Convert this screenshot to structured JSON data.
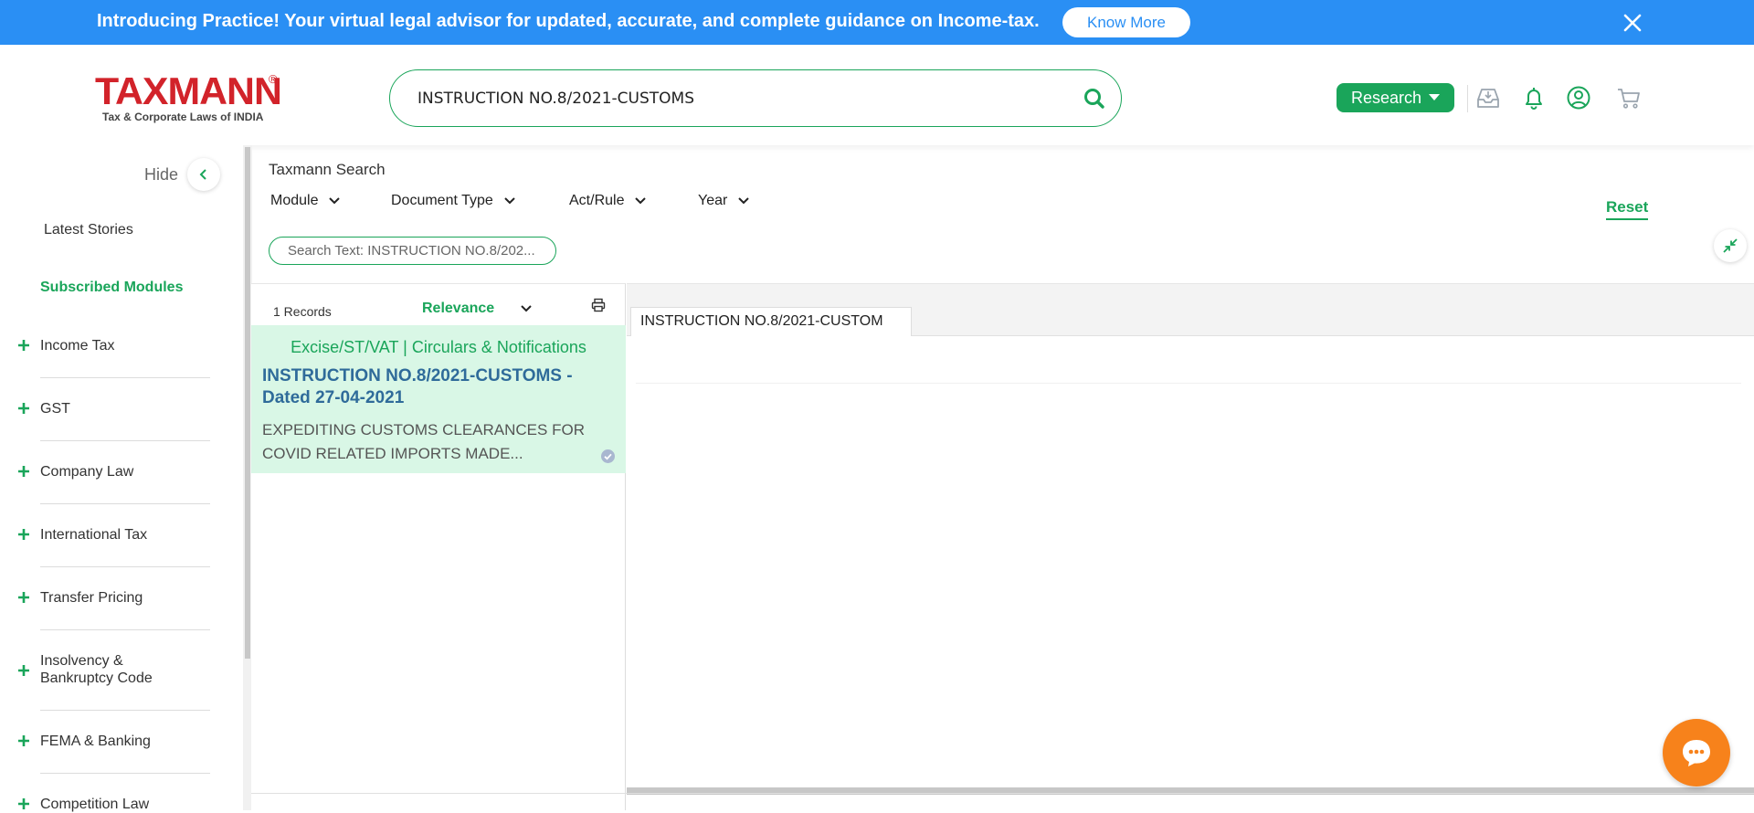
{
  "banner": {
    "text": "Introducing Practice! Your virtual legal advisor for updated, accurate, and complete guidance on Income-tax.",
    "button_label": "Know More",
    "background_color": "#2a8ff4",
    "close_icon": "close-icon"
  },
  "header": {
    "logo_text": "TAXMANN",
    "logo_registered": "®",
    "logo_tagline": "Tax & Corporate Laws of INDIA",
    "search_value": "INSTRUCTION NO.8/2021-CUSTOMS",
    "search_icon": "search-icon",
    "research_label": "Research",
    "icons": [
      "inbox-icon",
      "bell-icon",
      "user-icon",
      "cart-icon"
    ],
    "brand_color": "#d2232a",
    "accent_color": "#1aa55a"
  },
  "sidebar": {
    "hide_label": "Hide",
    "latest_stories": "Latest Stories",
    "subscribed_modules": "Subscribed Modules",
    "modules": [
      {
        "label": "Income Tax"
      },
      {
        "label": "GST"
      },
      {
        "label": "Company Law"
      },
      {
        "label": "International Tax"
      },
      {
        "label": "Transfer Pricing"
      },
      {
        "label": "Insolvency & Bankruptcy Code"
      },
      {
        "label": "FEMA & Banking"
      },
      {
        "label": "Competition Law"
      }
    ]
  },
  "search_panel": {
    "title": "Taxmann Search",
    "filters": [
      {
        "label": "Module"
      },
      {
        "label": "Document Type"
      },
      {
        "label": "Act/Rule"
      },
      {
        "label": "Year"
      }
    ],
    "reset_label": "Reset",
    "chip_text": "Search Text: INSTRUCTION NO.8/202..."
  },
  "results": {
    "count_text": "1 Records",
    "sort_label": "Relevance",
    "items": [
      {
        "category": "Excise/ST/VAT | Circulars & Notifications",
        "title": "INSTRUCTION NO.8/2021-CUSTOMS - Dated 27-04-2021",
        "description": "EXPEDITING CUSTOMS CLEARANCES FOR COVID RELATED IMPORTS MADE..."
      }
    ]
  },
  "document": {
    "tab_label": "INSTRUCTION NO.8/2021-CUSTOM"
  }
}
